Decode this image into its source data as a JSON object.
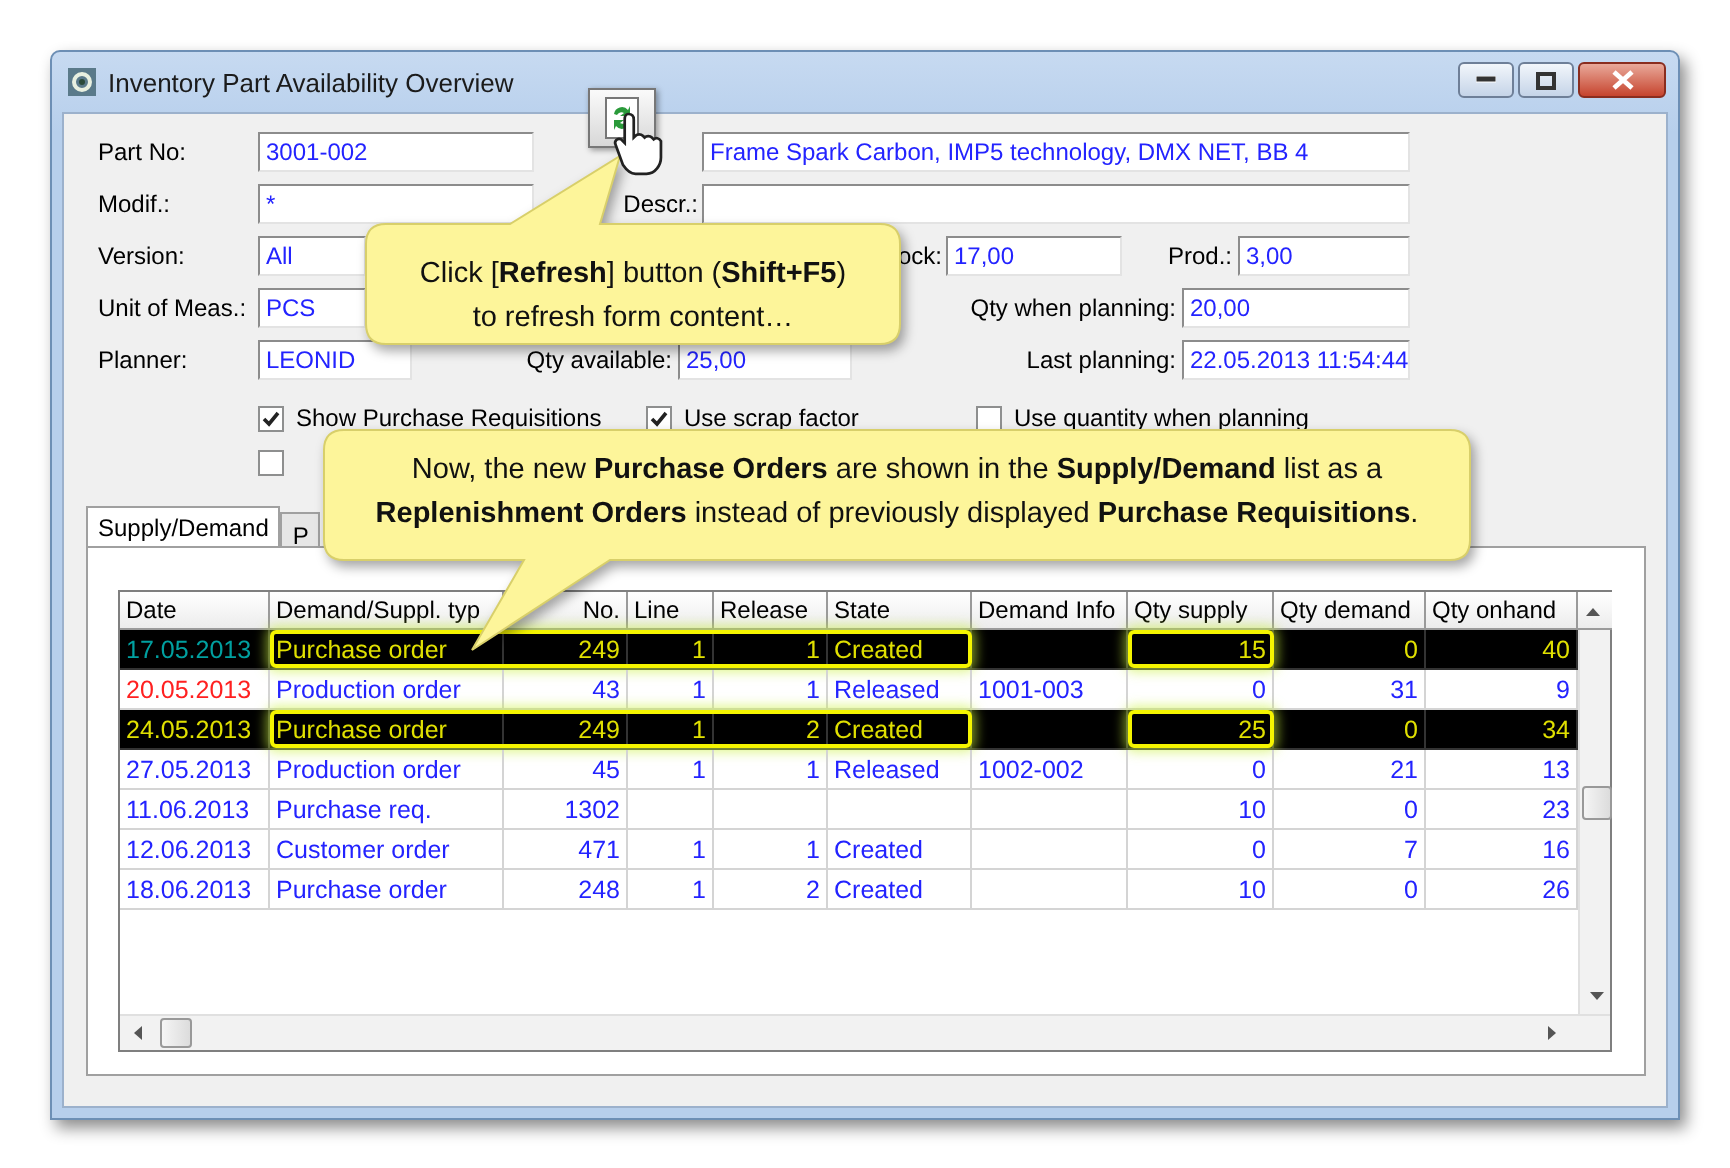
{
  "window": {
    "title": "Inventory Part Availability Overview"
  },
  "form": {
    "part_no": {
      "label": "Part No:",
      "value": "3001-002"
    },
    "name": {
      "value": "Frame Spark Carbon, IMP5 technology, DMX NET, BB 4"
    },
    "modif": {
      "label": "Modif.:",
      "value": "*"
    },
    "descr": {
      "label": "Descr.:"
    },
    "version": {
      "label": "Version:",
      "value": "All"
    },
    "stock": {
      "label": "ock:",
      "value": "17,00"
    },
    "prod": {
      "label": "Prod.:",
      "value": "3,00"
    },
    "unit": {
      "label": "Unit of Meas.:",
      "value": "PCS"
    },
    "qty_when_planning": {
      "label": "Qty when planning:",
      "value": "20,00"
    },
    "planner": {
      "label": "Planner:",
      "value": "LEONID"
    },
    "qty_available": {
      "label": "Qty available:",
      "value": "25,00"
    },
    "last_planning": {
      "label": "Last planning:",
      "value": "22.05.2013 11:54:44"
    }
  },
  "options": [
    {
      "label": "Show Purchase Requisitions",
      "checked": true
    },
    {
      "label": "Use scrap factor",
      "checked": true
    },
    {
      "label": "Use quantity when planning",
      "checked": false
    },
    {
      "checked": false
    }
  ],
  "tabs": [
    {
      "label": "Supply/Demand",
      "selected": true
    },
    {
      "label": "P",
      "selected": false
    }
  ],
  "table": {
    "columns": [
      "Date",
      "Demand/Suppl. typ",
      "No.",
      "Line",
      "Release",
      "State",
      "Demand Info",
      "Qty supply",
      "Qty demand",
      "Qty onhand"
    ],
    "rows": [
      {
        "date": "17.05.2013",
        "type": "Purchase order",
        "order_no": "249",
        "line": "1",
        "release": "1",
        "state": "Created",
        "qty_supply": "15",
        "qty_demand": "0",
        "qty_onhand": "40",
        "color": "#00a0a0",
        "selected": true,
        "highlighted": true
      },
      {
        "date": "20.05.2013",
        "type": "Production order",
        "order_no": "43",
        "line": "1",
        "release": "1",
        "state": "Released",
        "demand_info": "1001-003",
        "qty_supply": "0",
        "qty_demand": "31",
        "qty_onhand": "9",
        "color": "#ff2020",
        "selected": false,
        "highlighted": false
      },
      {
        "date": "24.05.2013",
        "type": "Purchase order",
        "order_no": "249",
        "line": "1",
        "release": "2",
        "state": "Created",
        "qty_supply": "25",
        "qty_demand": "0",
        "qty_onhand": "34",
        "color": "#e0e000",
        "selected": true,
        "highlighted": true
      },
      {
        "date": "27.05.2013",
        "type": "Production order",
        "order_no": "45",
        "line": "1",
        "release": "1",
        "state": "Released",
        "demand_info": "1002-002",
        "qty_supply": "0",
        "qty_demand": "21",
        "qty_onhand": "13",
        "color": "#2323ff",
        "selected": false,
        "highlighted": false
      },
      {
        "date": "11.06.2013",
        "type": "Purchase req.",
        "order_no": "1302",
        "qty_supply": "10",
        "qty_demand": "0",
        "qty_onhand": "23",
        "color": "#2323ff",
        "selected": false,
        "highlighted": false
      },
      {
        "date": "12.06.2013",
        "type": "Customer order",
        "order_no": "471",
        "line": "1",
        "release": "1",
        "state": "Created",
        "qty_supply": "0",
        "qty_demand": "7",
        "qty_onhand": "16",
        "color": "#2323ff",
        "selected": false,
        "highlighted": false
      },
      {
        "date": "18.06.2013",
        "type": "Purchase order",
        "order_no": "248",
        "line": "1",
        "release": "2",
        "state": "Created",
        "qty_supply": "10",
        "qty_demand": "0",
        "qty_onhand": "26",
        "color": "#2323ff",
        "selected": false,
        "highlighted": false
      }
    ]
  },
  "callouts": [
    {
      "lines": [
        "Click [**Refresh**] button (**Shift+F5**)",
        "to refresh form content…"
      ]
    },
    {
      "lines": [
        "Now, the new **Purchase Orders** are shown in the **Supply/Demand** list as a",
        "**Replenishment Orders** instead of previously displayed **Purchase Requisitions**."
      ]
    }
  ]
}
